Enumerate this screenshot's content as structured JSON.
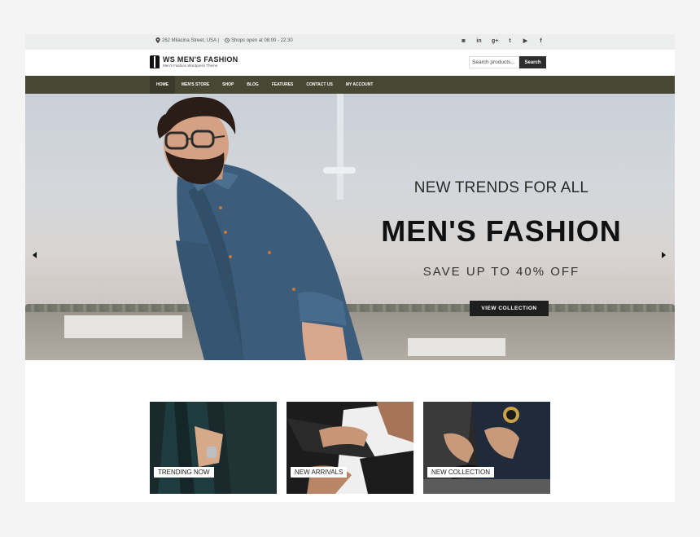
{
  "topbar": {
    "address": "262 Milacina Street, USA |",
    "hours": "Shops open at 08:00 - 22:30",
    "social": [
      "instagram-icon",
      "linkedin-icon",
      "googleplus-icon",
      "twitter-icon",
      "youtube-icon",
      "facebook-icon"
    ],
    "social_glyphs": [
      "◙",
      "in",
      "g+",
      "t",
      "▶",
      "f"
    ]
  },
  "header": {
    "logo_title": "WS MEN'S FASHION",
    "logo_subtitle": "Men's Fashion Wordpress Theme",
    "search_placeholder": "Search products...",
    "search_button": "Search"
  },
  "nav": {
    "items": [
      "HOME",
      "MEN'S STORE",
      "SHOP",
      "BLOG",
      "FEATURES",
      "CONTACT US",
      "MY ACCOUNT"
    ]
  },
  "hero": {
    "line1": "NEW TRENDS FOR ALL",
    "line2": "MEN'S FASHION",
    "line3": "SAVE UP TO 40% OFF",
    "button": "VIEW COLLECTION"
  },
  "cards": [
    {
      "label": "TRENDING NOW"
    },
    {
      "label": "NEW ARRIVALS"
    },
    {
      "label": "NEW COLLECTION"
    }
  ],
  "colors": {
    "nav_bg": "#484734",
    "button_dark": "#1e1e1e",
    "topbar_bg": "#eceeed"
  }
}
